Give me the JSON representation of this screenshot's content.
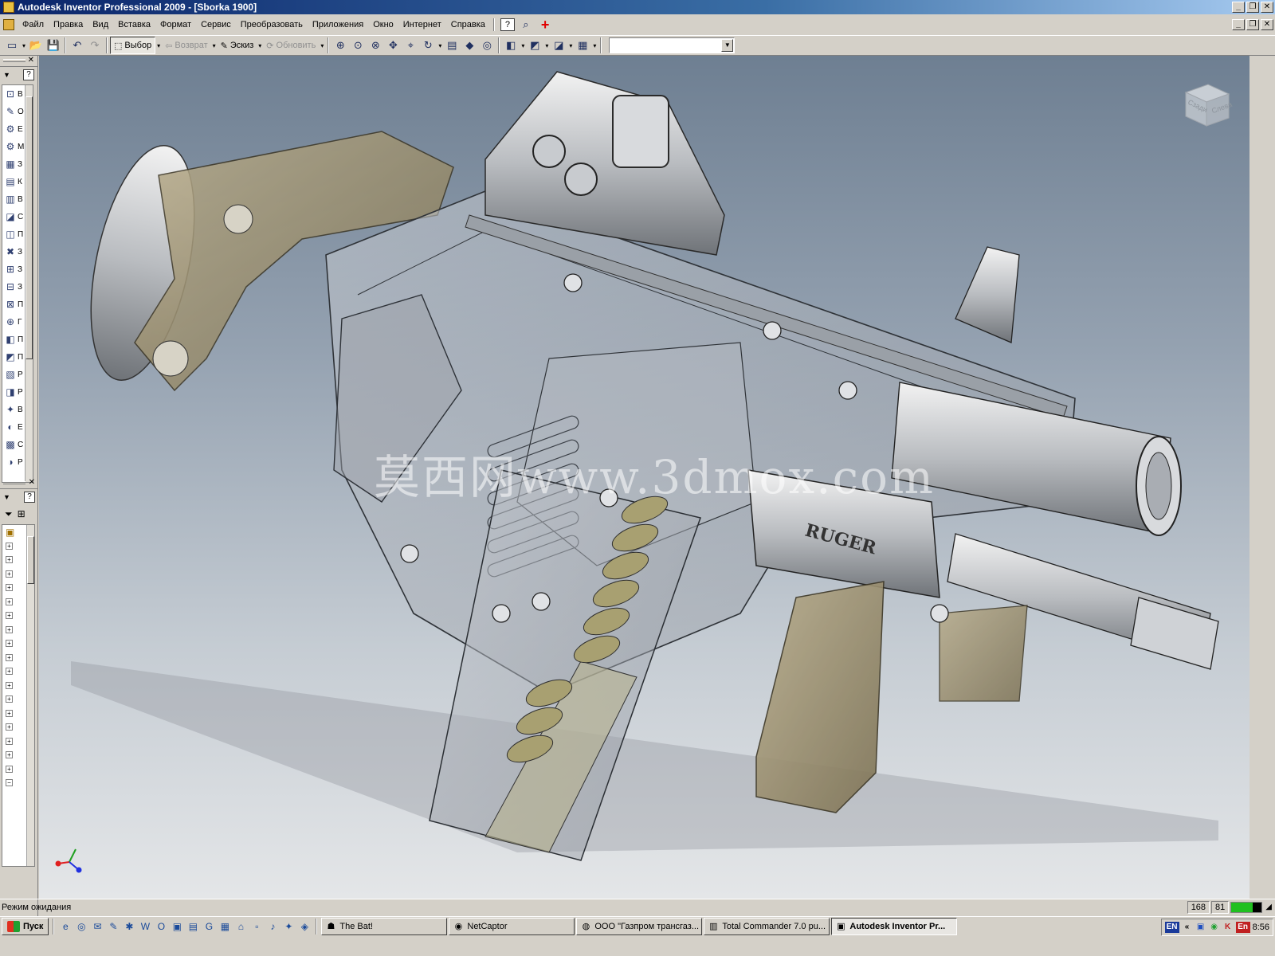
{
  "window": {
    "title": "Autodesk Inventor Professional 2009 - [Sborka 1900]",
    "buttons": [
      "_",
      "❐",
      "✕"
    ]
  },
  "menu": {
    "items": [
      "Файл",
      "Правка",
      "Вид",
      "Вставка",
      "Формат",
      "Сервис",
      "Преобразовать",
      "Приложения",
      "Окно",
      "Интернет",
      "Справка"
    ],
    "help_icon": "?"
  },
  "toolbar": {
    "select_label": "Выбор",
    "return_label": "Возврат",
    "sketch_label": "Эскиз",
    "update_label": "Обновить",
    "combo_value": ""
  },
  "panel": {
    "help": "?",
    "tool_labels": [
      "В",
      "О",
      "Е",
      "М",
      "З",
      "К",
      "В",
      "С",
      "П",
      "З",
      "З",
      "З",
      "П",
      "Г",
      "П",
      "П",
      "Р",
      "Р",
      "В",
      "Е",
      "С",
      "Р"
    ]
  },
  "viewport": {
    "watermark": "莫西网www.3dmox.com",
    "viewcube_front": "Сзади",
    "viewcube_side": "Слева",
    "brand_marking": "RUGER"
  },
  "status": {
    "text": "Режим ожидания",
    "value1": "168",
    "value2": "81",
    "memory_fraction": 0.7
  },
  "taskbar": {
    "start_label": "Пуск",
    "tasks": [
      {
        "label": "The Bat!",
        "icon": "bat-icon"
      },
      {
        "label": "NetCaptor",
        "icon": "netcaptor-icon"
      },
      {
        "label": "ООО \"Газпром трансгаз...",
        "icon": "browser-icon"
      },
      {
        "label": "Total Commander 7.0 pu...",
        "icon": "total-commander-icon"
      },
      {
        "label": "Autodesk Inventor Pr...",
        "icon": "inventor-icon"
      }
    ],
    "language": "EN",
    "tray_lang": "En",
    "clock": "8:56"
  },
  "colors": {
    "title_start": "#0a246a",
    "title_end": "#a6caf0",
    "viewport_top": "#6e7f92",
    "viewport_bottom": "#e4e6e8"
  }
}
